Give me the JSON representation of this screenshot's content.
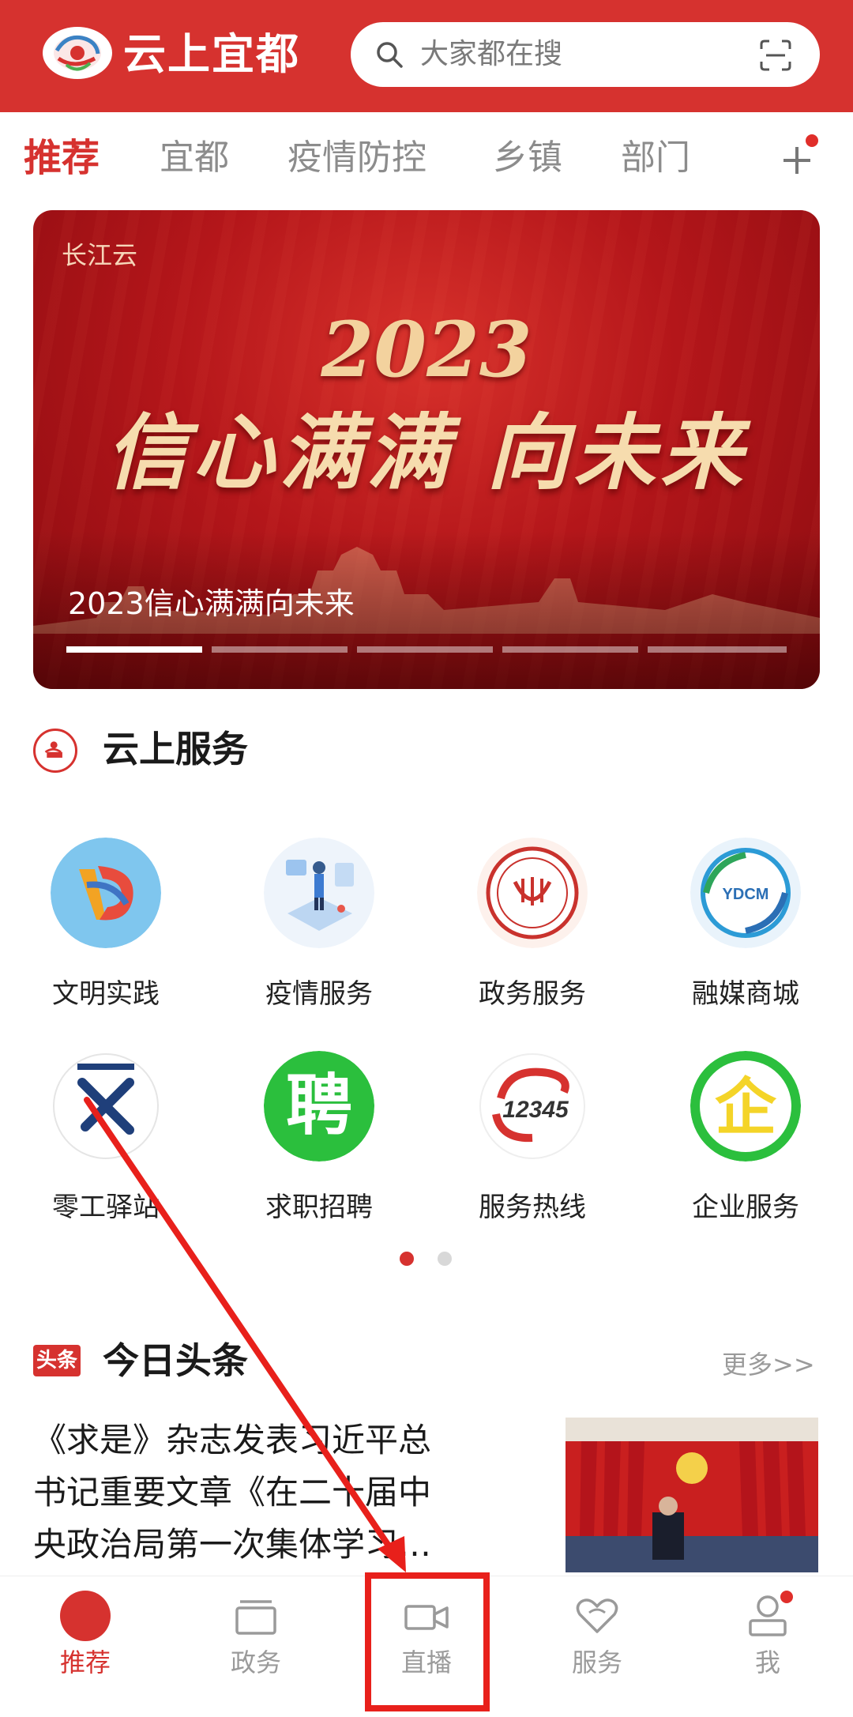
{
  "header": {
    "app_title": "云上宜都",
    "search_placeholder": "大家都在搜"
  },
  "tabs": [
    {
      "label": "推荐",
      "active": true
    },
    {
      "label": "宜都",
      "active": false
    },
    {
      "label": "疫情防控",
      "active": false
    },
    {
      "label": "乡镇",
      "active": false
    },
    {
      "label": "部门",
      "active": false
    }
  ],
  "banner": {
    "brand": "长江云",
    "year": "2023",
    "slogan": "信心满满 向未来",
    "caption": "2023信心满满向未来",
    "indicator_count": 5,
    "active_indicator": 0
  },
  "services": {
    "title": "云上服务",
    "items": [
      {
        "label": "文明实践",
        "icon": "civilization-practice-icon"
      },
      {
        "label": "疫情服务",
        "icon": "epidemic-service-icon"
      },
      {
        "label": "政务服务",
        "icon": "government-service-icon"
      },
      {
        "label": "融媒商城",
        "icon": "media-mall-icon"
      },
      {
        "label": "零工驿站",
        "icon": "gig-station-icon"
      },
      {
        "label": "求职招聘",
        "icon": "recruitment-icon"
      },
      {
        "label": "服务热线",
        "icon": "hotline-12345-icon"
      },
      {
        "label": "企业服务",
        "icon": "enterprise-service-icon"
      }
    ],
    "hotline_number": "12345",
    "recruit_char": "聘",
    "enterprise_char": "企",
    "media_logo_text": "YDCM",
    "page_count": 2,
    "active_page": 0
  },
  "headlines": {
    "badge": "头条",
    "title": "今日头条",
    "more": "更多>>",
    "news_lines": [
      "《求是》杂志发表习近平总",
      "书记重要文章《在二十届中",
      "央政治局第一次集体学习…"
    ]
  },
  "bottom_nav": [
    {
      "label": "推荐",
      "icon": "recommend-icon",
      "active": true
    },
    {
      "label": "政务",
      "icon": "government-icon",
      "active": false
    },
    {
      "label": "直播",
      "icon": "video-camera-icon",
      "active": false
    },
    {
      "label": "服务",
      "icon": "heart-service-icon",
      "active": false
    },
    {
      "label": "我",
      "icon": "user-icon",
      "active": false
    }
  ],
  "colors": {
    "brand_red": "#d6322f",
    "annotation_red": "#e8201b",
    "inactive_gray": "#9a9a9a"
  }
}
